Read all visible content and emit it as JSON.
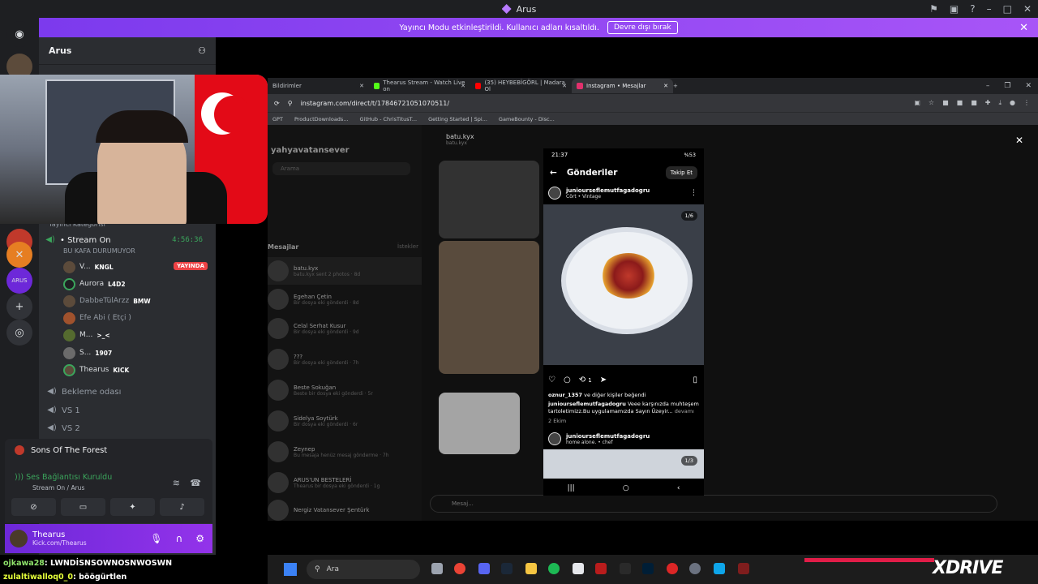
{
  "window": {
    "title": "Arus"
  },
  "banner": {
    "text": "Yayıncı Modu etkinleştirildi. Kullanıcı adları kısaltıldı.",
    "button": "Devre dışı bırak"
  },
  "server": {
    "name": "Arus"
  },
  "channels": {
    "category": "Yayıncı Kategorisi",
    "stream_on": "• Stream On",
    "timer": "4:56:36",
    "stream_sub": "BU KAFA DURUMUYOR",
    "live_badge": "YAYINDA",
    "members": [
      {
        "name": "V...",
        "tag": "KNGL"
      },
      {
        "name": "Aurora",
        "tag": "L4D2"
      },
      {
        "name": "DabbeTülArzz",
        "tag": "BMW"
      },
      {
        "name": "Efe Abi ( Etçi )",
        "tag": ""
      },
      {
        "name": "M...",
        "tag": ">_<"
      },
      {
        "name": "S...",
        "tag": "1907"
      },
      {
        "name": "Thearus",
        "tag": "KICK"
      }
    ],
    "bekleme": "Bekleme odası",
    "vs1": "VS 1",
    "vs2": "VS 2"
  },
  "voice_panel": {
    "game": "Sons Of The Forest",
    "connection": "Ses Bağlantısı Kuruldu",
    "sub": "Stream On / Arus"
  },
  "user_panel": {
    "name": "Thearus",
    "status": "Kick.com/Thearus"
  },
  "browser": {
    "tabs": [
      {
        "label": "Bildirimler"
      },
      {
        "label": "Thearus Stream - Watch Live on"
      },
      {
        "label": "(35) HEYBEBİGÖRL | Madara Ol"
      },
      {
        "label": "Instagram • Mesajlar"
      }
    ],
    "url": "instagram.com/direct/t/17846721051070511/",
    "bookmarks": [
      "GPT",
      "ProductDownloads...",
      "GitHub - ChrisTitusT...",
      "Getting Started | Spi...",
      "GameBounty - Disc..."
    ]
  },
  "instagram": {
    "username": "yahyavatansever",
    "search": "Arama",
    "messages_label": "Mesajlar",
    "requests_label": "İstekler",
    "chat_name": "batu.kyx",
    "chat_sub": "batu.kyx",
    "dms": [
      {
        "name": "batu.kyx",
        "sub": "batu.kyx sent 2 photos · 8d"
      },
      {
        "name": "Egehan Çetin",
        "sub": "Bir dosya eki gönderdi · 8d"
      },
      {
        "name": "Celal Serhat Kusur",
        "sub": "Bir dosya eki gönderdi · 9d"
      },
      {
        "name": "???",
        "sub": "Bir dosya eki gönderdi · 7h"
      },
      {
        "name": "Beste Sokuğan",
        "sub": "Beste bir dosya eki gönderdi · 5r"
      },
      {
        "name": "Sidelya Soytürk",
        "sub": "Bir dosya eki gönderdi · 6r"
      },
      {
        "name": "Zeynep",
        "sub": "Bu mesaja henüz mesaj gönderme · 7h"
      },
      {
        "name": "ARUS'UN BESTELERİ",
        "sub": "Thearus bir dosya eki gönderdi · 1g"
      },
      {
        "name": "Nergiz Vatansever Şentürk",
        "sub": ""
      }
    ],
    "input_placeholder": "Mesaj..."
  },
  "phone": {
    "time": "21:37",
    "battery": "%53",
    "title": "Gönderiler",
    "follow": "Takip Et",
    "post1_user": "juniourseflemutfagadogru",
    "post1_music": "Cört • Vintage",
    "post1_counter": "1/6",
    "likes_line_user": "oznur_1357",
    "likes_line_rest": "ve diğer kişiler beğendi",
    "caption_user": "juniourseflemutfagadogru",
    "caption_text": "Veee karşınızda muhteşem tartoletimizz.Bu uygulamamızda Sayın Üzeyir...",
    "caption_more": "devamı",
    "date": "2 Ekim",
    "repost_count": "1",
    "post2_user": "juniourseflemutfagadogru",
    "post2_music": "home alone. • chef",
    "post2_counter": "1/3"
  },
  "chat_overlay": [
    {
      "user": "ojkawa28",
      "text": "LWNDİSNSOWNOSNWOSWN"
    },
    {
      "user": "zulaltiwalloq0_0",
      "text": "böögürtlen"
    }
  ],
  "taskbar": {
    "search": "Ara"
  },
  "watermark": "XDRIVE",
  "colors": {
    "discord_bg": "#2b2d31",
    "accent_purple": "#9333ea",
    "live_red": "#ed4245",
    "connected_green": "#3ba55c"
  }
}
